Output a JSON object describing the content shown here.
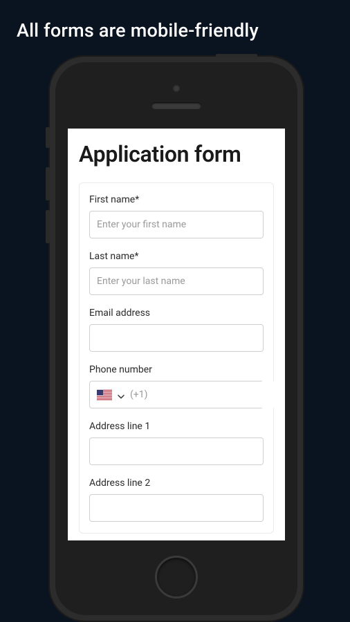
{
  "headline": "All forms are mobile-friendly",
  "form": {
    "title": "Application form",
    "fields": {
      "first_name": {
        "label": "First name*",
        "placeholder": "Enter your first name",
        "value": ""
      },
      "last_name": {
        "label": "Last name*",
        "placeholder": "Enter your last name",
        "value": ""
      },
      "email": {
        "label": "Email address",
        "placeholder": "",
        "value": ""
      },
      "phone": {
        "label": "Phone number",
        "prefix": "(+1)",
        "country": "US",
        "value": ""
      },
      "address1": {
        "label": "Address line 1",
        "placeholder": "",
        "value": ""
      },
      "address2": {
        "label": "Address line 2",
        "placeholder": "",
        "value": ""
      }
    }
  }
}
